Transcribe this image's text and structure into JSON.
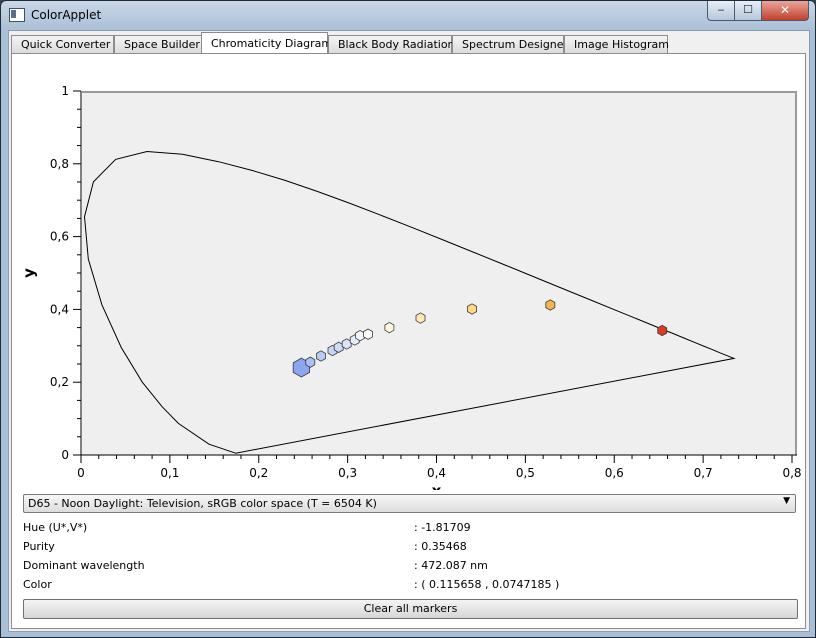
{
  "window": {
    "title": "ColorApplet",
    "min_glyph": "‒",
    "max_glyph": "☐",
    "close_glyph": "✕"
  },
  "tabs": [
    {
      "label": "Quick Converter"
    },
    {
      "label": "Space Builder"
    },
    {
      "label": "Chromaticity Diagram",
      "active": true
    },
    {
      "label": "Black Body Radiation"
    },
    {
      "label": "Spectrum Designer"
    },
    {
      "label": "Image Histogram"
    }
  ],
  "chart_data": {
    "type": "scatter",
    "xlabel": "x",
    "ylabel": "y",
    "xlim": [
      0,
      0.8
    ],
    "ylim": [
      0,
      1
    ],
    "xticks": [
      0,
      0.1,
      0.2,
      0.3,
      0.4,
      0.5,
      0.6,
      0.7,
      0.8
    ],
    "yticks": [
      0,
      0.2,
      0.4,
      0.6,
      0.8,
      1
    ],
    "xtick_labels": [
      "0",
      "0,1",
      "0,2",
      "0,3",
      "0,4",
      "0,5",
      "0,6",
      "0,7",
      "0,8"
    ],
    "ytick_labels": [
      "0",
      "0,2",
      "0,4",
      "0,6",
      "0,8",
      "1"
    ],
    "grid": false,
    "spectral_locus": [
      [
        0.1741,
        0.005
      ],
      [
        0.144,
        0.0297
      ],
      [
        0.1096,
        0.0868
      ],
      [
        0.0913,
        0.1327
      ],
      [
        0.0687,
        0.2007
      ],
      [
        0.0454,
        0.295
      ],
      [
        0.0235,
        0.4127
      ],
      [
        0.0082,
        0.5384
      ],
      [
        0.0039,
        0.6548
      ],
      [
        0.0139,
        0.7502
      ],
      [
        0.0389,
        0.812
      ],
      [
        0.0743,
        0.8338
      ],
      [
        0.1142,
        0.8262
      ],
      [
        0.1547,
        0.8059
      ],
      [
        0.1929,
        0.7816
      ],
      [
        0.2296,
        0.7543
      ],
      [
        0.2658,
        0.7243
      ],
      [
        0.3016,
        0.6923
      ],
      [
        0.3373,
        0.6589
      ],
      [
        0.3731,
        0.6245
      ],
      [
        0.4087,
        0.5896
      ],
      [
        0.4441,
        0.5547
      ],
      [
        0.4788,
        0.5202
      ],
      [
        0.5125,
        0.4866
      ],
      [
        0.5448,
        0.4544
      ],
      [
        0.5752,
        0.4242
      ],
      [
        0.6029,
        0.3965
      ],
      [
        0.627,
        0.3725
      ],
      [
        0.6482,
        0.3514
      ],
      [
        0.6658,
        0.334
      ],
      [
        0.6801,
        0.3197
      ],
      [
        0.6915,
        0.3083
      ],
      [
        0.7006,
        0.2993
      ],
      [
        0.7079,
        0.292
      ],
      [
        0.714,
        0.2859
      ],
      [
        0.719,
        0.2809
      ],
      [
        0.7347,
        0.2653
      ]
    ],
    "markers": [
      {
        "x": 0.248,
        "y": 0.24,
        "color": "#8aa6ef",
        "size": "large"
      },
      {
        "x": 0.258,
        "y": 0.255,
        "color": "#aabff3",
        "size": "small"
      },
      {
        "x": 0.27,
        "y": 0.272,
        "color": "#b8cbf5",
        "size": "small"
      },
      {
        "x": 0.283,
        "y": 0.287,
        "color": "#c6d4f6",
        "size": "small"
      },
      {
        "x": 0.29,
        "y": 0.296,
        "color": "#d0dbf7",
        "size": "small"
      },
      {
        "x": 0.299,
        "y": 0.305,
        "color": "#dbe3f8",
        "size": "small"
      },
      {
        "x": 0.308,
        "y": 0.316,
        "color": "#e6ecfa",
        "size": "small"
      },
      {
        "x": 0.314,
        "y": 0.328,
        "color": "#f2f4fb",
        "size": "small"
      },
      {
        "x": 0.323,
        "y": 0.332,
        "color": "#fdfcf7",
        "size": "small"
      },
      {
        "x": 0.347,
        "y": 0.35,
        "color": "#fff6e2",
        "size": "small"
      },
      {
        "x": 0.382,
        "y": 0.376,
        "color": "#ffe9b6",
        "size": "small"
      },
      {
        "x": 0.44,
        "y": 0.401,
        "color": "#fcd887",
        "size": "small"
      },
      {
        "x": 0.528,
        "y": 0.412,
        "color": "#f4b54c",
        "size": "small"
      },
      {
        "x": 0.654,
        "y": 0.342,
        "color": "#d83a22",
        "size": "small"
      }
    ]
  },
  "illuminant_select": {
    "value": "D65 - Noon Daylight: Television, sRGB color space (T = 6504 K)",
    "arrow_icon": "dropdown-arrow-icon"
  },
  "info": [
    {
      "label": "Hue (U*,V*)",
      "value": ": -1.81709"
    },
    {
      "label": "Purity",
      "value": ": 0.35468"
    },
    {
      "label": "Dominant wavelength",
      "value": ": 472.087 nm"
    },
    {
      "label": "Color",
      "value": ": ( 0.115658 , 0.0747185 )"
    }
  ],
  "clear_button": {
    "label": "Clear all markers"
  }
}
